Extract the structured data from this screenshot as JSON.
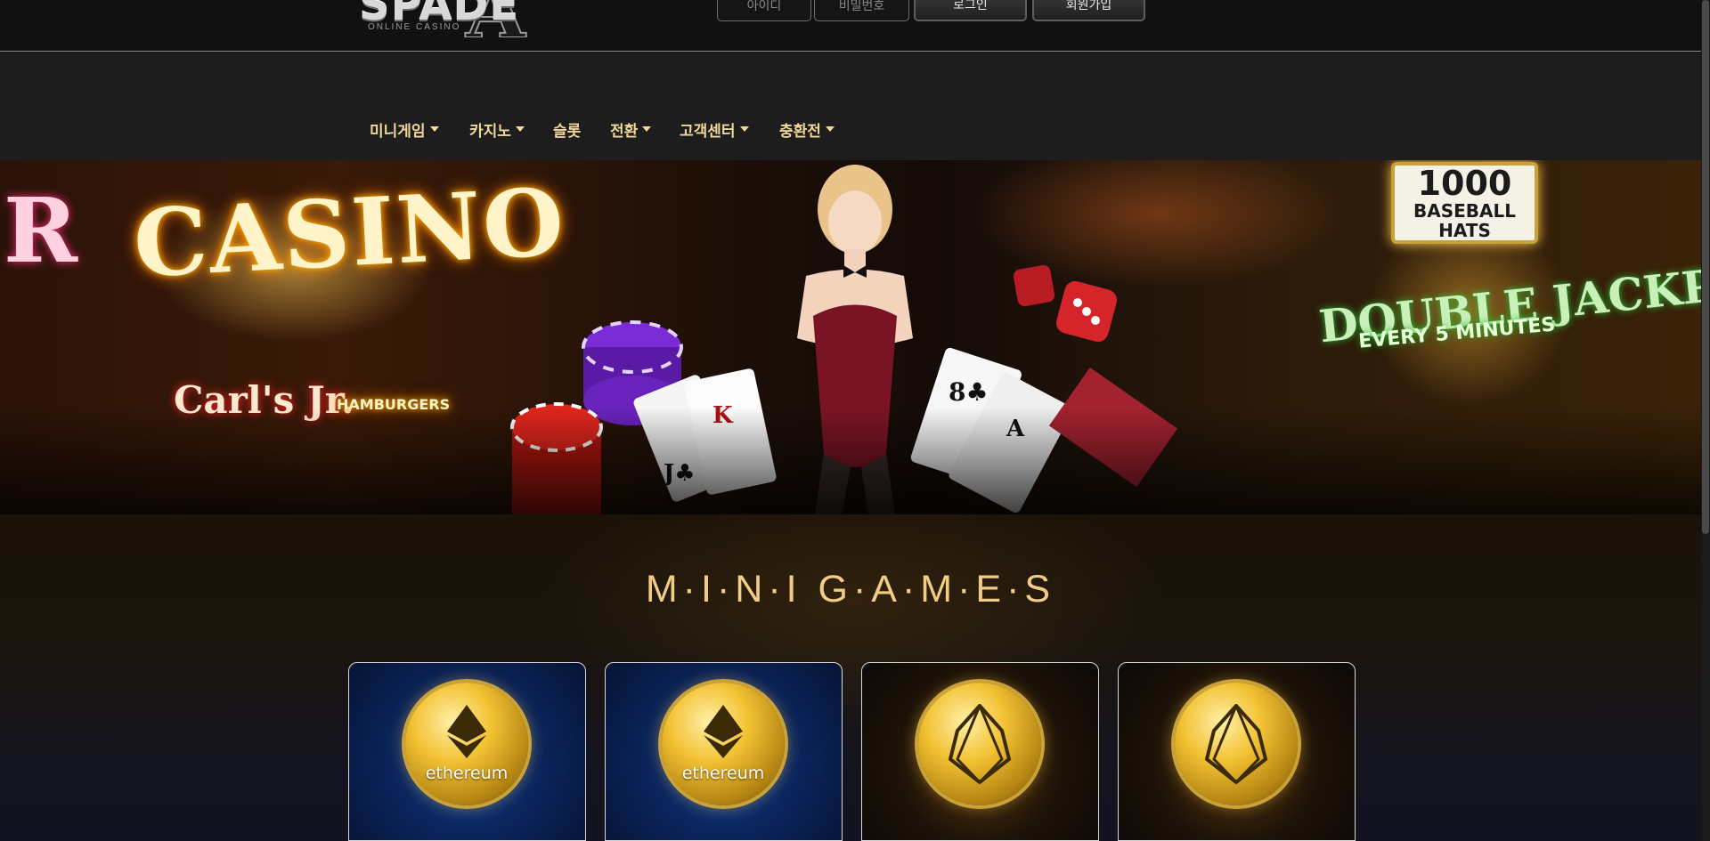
{
  "header": {
    "logo": {
      "word": "SPADE",
      "letter": "A",
      "tagline": "ONLINE CASINO"
    },
    "login": {
      "id_placeholder": "아이디",
      "password_placeholder": "비밀번호",
      "login_button": "로그인",
      "signup_button": "회원가입"
    }
  },
  "nav": {
    "items": [
      {
        "label": "미니게임",
        "dropdown": true
      },
      {
        "label": "카지노",
        "dropdown": true
      },
      {
        "label": "슬롯",
        "dropdown": false
      },
      {
        "label": "전환",
        "dropdown": true
      },
      {
        "label": "고객센터",
        "dropdown": true
      },
      {
        "label": "충환전",
        "dropdown": true
      }
    ]
  },
  "banner": {
    "signs": {
      "r": "R",
      "casino": "CASINO",
      "carls": "Carl's Jr.",
      "hamburgers": "HAMBURGERS",
      "hats_number": "1000",
      "hats_line1": "BASEBALL",
      "hats_line2": "HATS",
      "jackpot": "DOUBLE JACKPOT",
      "every": "EVERY 5 MINUTES"
    }
  },
  "games": {
    "title": "M·I·N·I  G·A·M·E·S",
    "cards": [
      {
        "coin": "ethereum"
      },
      {
        "coin": "ethereum"
      },
      {
        "coin": "EOS"
      },
      {
        "coin": "EOS"
      }
    ]
  },
  "colors": {
    "nav_text": "#f2d79a",
    "title_gold": "#f3cc83",
    "header_bg": "#111111",
    "nav_bg": "#1d1d1d"
  }
}
